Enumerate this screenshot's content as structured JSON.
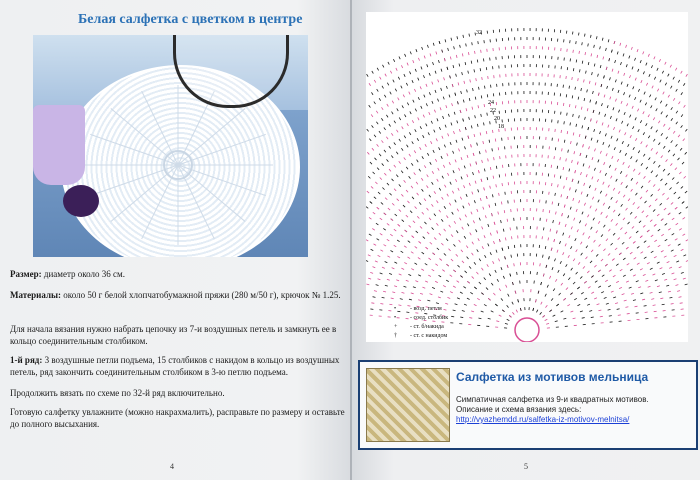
{
  "left_page": {
    "title": "Белая салфетка с цветком в центре",
    "size_label": "Размер:",
    "size_text": " диаметр около 36 см.",
    "materials_label": "Материалы:",
    "materials_text": " около 50 г белой хлопчатобумажной пряжи (280 м/50 г), крючок № 1.25.",
    "intro_1": "Для начала вязания нужно набрать цепочку из 7-и воздушных петель и замкнуть ее в",
    "intro_2": "кольцо соединительным столбиком.",
    "row1_label": "1-й ряд:",
    "row1_text_1": " 3 воздушные петли подъема, 15 столбиков с накидом в кольцо из воздушных",
    "row1_text_2": "петель, ряд закончить соединительным столбиком в 3-ю петлю подъема.",
    "continue_text": "Продолжить вязать по схеме по 32-й ряд включительно.",
    "finish_1": "Готовую салфетку увлажните (можно накрахмалить), расправьте по размеру и оставьте",
    "finish_2": "до полного высыхания.",
    "page_number": "4"
  },
  "right_page": {
    "legend": [
      {
        "symbol": "•",
        "text": "- возд. петля"
      },
      {
        "symbol": "•",
        "text": "- соед. столбик"
      },
      {
        "symbol": "+",
        "text": "- ст. б/накида"
      },
      {
        "symbol": "†",
        "text": "- ст. с накидом"
      }
    ],
    "row_labels": [
      "32",
      "24",
      "22",
      "20",
      "18"
    ],
    "promo": {
      "title": "Салфетка из мотивов мельница",
      "desc_1": "Симпатичная салфетка из 9-и квадратных мотивов.",
      "desc_2": "Описание и схема вязания здесь:",
      "link": "http://vyazhemdd.ru/salfetka-iz-motivov-melnitsa/"
    },
    "page_number": "5"
  },
  "colors": {
    "title_blue": "#2c72b6",
    "chart_pink": "#d94f95",
    "chart_dark": "#1a1a1a",
    "promo_border": "#1b3f73"
  }
}
